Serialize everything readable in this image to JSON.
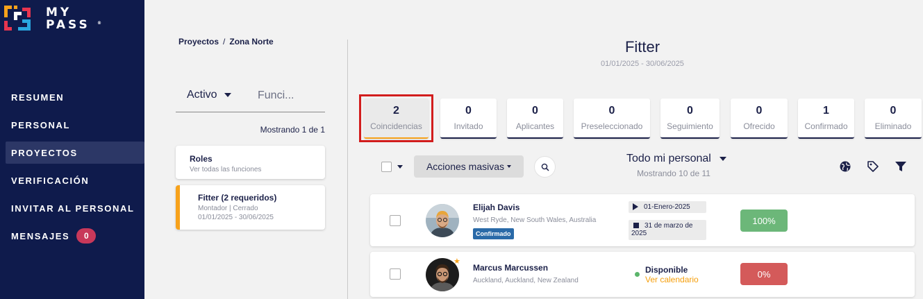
{
  "brand": {
    "logo_line1": "MY",
    "logo_line2": "PASS",
    "reg": "®"
  },
  "nav": {
    "items": [
      {
        "label": "RESUMEN"
      },
      {
        "label": "PERSONAL"
      },
      {
        "label": "PROYECTOS",
        "active": true
      },
      {
        "label": "VERIFICACIÓN"
      },
      {
        "label": "INVITAR AL PERSONAL"
      },
      {
        "label": "MENSAJES",
        "badge": "0"
      }
    ]
  },
  "breadcrumb": {
    "root": "Proyectos",
    "separator": "/",
    "current": "Zona Norte"
  },
  "left_panel": {
    "status_filter": "Activo",
    "function_search_placeholder": "Funci...",
    "showing": "Mostrando 1 de 1",
    "cards": [
      {
        "title": "Roles",
        "subtitle": "Ver todas las funciones"
      },
      {
        "title": "Fitter (2 requeridos)",
        "subtitle": "Montador | Cerrado",
        "dates": "01/01/2025 - 30/06/2025"
      }
    ]
  },
  "job": {
    "title": "Fitter",
    "dates": "01/01/2025 - 30/06/2025"
  },
  "tabs": [
    {
      "count": "2",
      "label": "Coincidencias",
      "active": true
    },
    {
      "count": "0",
      "label": "Invitado"
    },
    {
      "count": "0",
      "label": "Aplicantes"
    },
    {
      "count": "0",
      "label": "Preseleccionado"
    },
    {
      "count": "0",
      "label": "Seguimiento"
    },
    {
      "count": "0",
      "label": "Ofrecido"
    },
    {
      "count": "1",
      "label": "Confirmado"
    },
    {
      "count": "0",
      "label": "Eliminado"
    }
  ],
  "toolbar": {
    "bulk_actions": "Acciones masivas",
    "staff_filter": "Todo mi personal",
    "showing": "Mostrando 10 de 11"
  },
  "candidates": [
    {
      "name": "Elijah Davis",
      "location": "West Ryde, New South Wales, Australia",
      "status": "Confirmado",
      "start_date": "01-Enero-2025",
      "end_date_line1": "31 de marzo de",
      "end_date_line2": "2025",
      "match": "100%"
    },
    {
      "name": "Marcus Marcussen",
      "location": "Auckland, Auckland, New Zealand",
      "availability": "Disponible",
      "calendar_link": "Ver calendario",
      "match": "0%"
    }
  ],
  "colors": {
    "sidebar_bg": "#0f1b4c",
    "accent_orange": "#f7a21b",
    "highlight_red": "#d21d1d",
    "match_green": "#6cb779",
    "match_red": "#d45a5a",
    "confirmed_blue": "#2a6aa8",
    "badge_pink": "#c8385a"
  }
}
